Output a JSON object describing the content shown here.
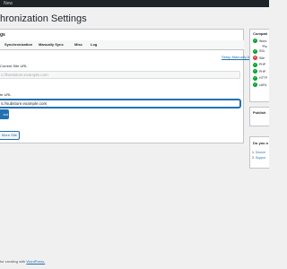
{
  "adminbar": {
    "new_label": "New"
  },
  "page": {
    "title": "hronization Settings"
  },
  "panel": {
    "title": "gs",
    "tabs": [
      {
        "label": "Synchronization",
        "active": false
      },
      {
        "label": "Manually Sync",
        "active": false
      },
      {
        "label": "Misc",
        "active": false
      },
      {
        "label": "Log",
        "active": false
      }
    ],
    "manual_link": "Setup Manually API Key",
    "current_site_label": "Current Site URL",
    "current_site_value": "c://hentstore.example.com",
    "target_site_label": "te URL",
    "target_site_value": "s://substore.example.com",
    "primary_button": "ect",
    "secondary_button": "More Site"
  },
  "compat": {
    "title": "Compati",
    "items": [
      {
        "status": "ok",
        "label": "Word"
      },
      {
        "status": "ok",
        "label": "SSL"
      },
      {
        "status": "err",
        "label": "Site"
      },
      {
        "status": "ok",
        "label": "PHP"
      },
      {
        "status": "ok",
        "label": "PHP"
      },
      {
        "status": "ok",
        "label": "HTTP"
      },
      {
        "status": "ok",
        "label": "cURL"
      }
    ],
    "sub_note": "'Plu"
  },
  "publish": {
    "title": "Publish"
  },
  "help": {
    "title": "Do you n",
    "links": [
      {
        "num": "1.",
        "label": "Docum"
      },
      {
        "num": "2.",
        "label": "Suppor"
      }
    ]
  },
  "footer": {
    "prefix": "for creating with ",
    "link": "WordPress."
  },
  "colors": {
    "accent": "#2271b1",
    "ok": "#00a32a",
    "error": "#d63638",
    "adminbar": "#1d2327"
  }
}
